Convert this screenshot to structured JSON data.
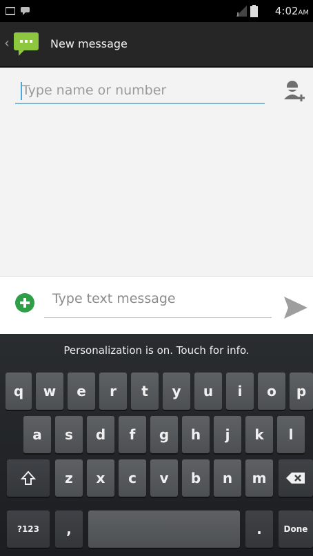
{
  "status_bar": {
    "time": "4:02",
    "ampm": "AM"
  },
  "action_bar": {
    "title": "New message",
    "back_icon": "chevron-left-icon",
    "app_icon": "messaging-icon"
  },
  "recipient": {
    "placeholder": "Type name or number",
    "value": ""
  },
  "compose": {
    "placeholder": "Type text message",
    "value": ""
  },
  "keyboard": {
    "suggestion": "Personalization is on. Touch for info.",
    "row1": [
      "q",
      "w",
      "e",
      "r",
      "t",
      "y",
      "u",
      "i",
      "o",
      "p"
    ],
    "row2": [
      "a",
      "s",
      "d",
      "f",
      "g",
      "h",
      "j",
      "k",
      "l"
    ],
    "row3": [
      "z",
      "x",
      "c",
      "v",
      "b",
      "n",
      "m"
    ],
    "symbols_key": "?123",
    "comma_key": ",",
    "period_key": ".",
    "done_key": "Done"
  },
  "colors": {
    "accent": "#4aa9d8",
    "add_green": "#2e9e47",
    "app_green": "#8dc63f"
  }
}
